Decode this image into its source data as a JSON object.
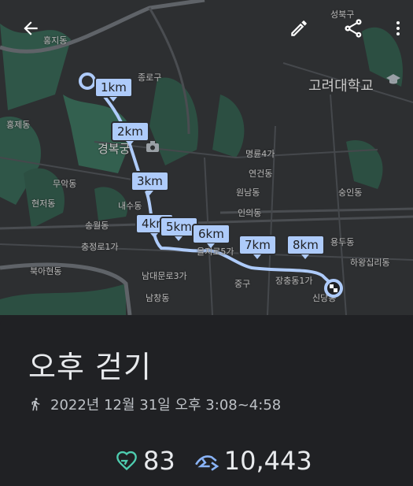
{
  "map": {
    "labels": {
      "hongji": "홍지동",
      "jongno": "종로구",
      "hongje": "홍제동",
      "gyeongbok": "경복궁",
      "muak": "무악동",
      "hyeonjeo": "현저동",
      "naesu": "내수동",
      "chungjeong": "충정로1가",
      "songwol": "송월동",
      "bukahyeon": "북아현동",
      "namdaemun": "남대문로3가",
      "namchang": "남창동",
      "euljiro": "을지로5가",
      "junggu": "중구",
      "jangchung": "장충동1가",
      "sindang": "신당동",
      "myeongryun": "명륜4가",
      "yeongeon": "연건동",
      "wonnam": "원남동",
      "inui": "인의동",
      "sungin": "숭인동",
      "korea_univ": "고려대학교",
      "seongbuk": "성북구",
      "hayang": "하왕십리동",
      "yong": "용두동"
    },
    "km_markers": [
      "1km",
      "2km",
      "3km",
      "4km",
      "5km",
      "6km",
      "7km",
      "8km"
    ],
    "route_color": "#aecbfa"
  },
  "toolbar": {
    "back_icon": "arrow-left-icon",
    "edit_icon": "pencil-icon",
    "share_icon": "share-icon",
    "more_icon": "more-vert-icon"
  },
  "activity": {
    "title": "오후 걷기",
    "datetime": "2022년 12월 31일 오후 3:08~4:58",
    "heart_points": "83",
    "steps": "10,443"
  },
  "colors": {
    "heart_points": "#4ecdb0",
    "steps": "#8ab4f8",
    "sheet_bg": "#202124"
  }
}
